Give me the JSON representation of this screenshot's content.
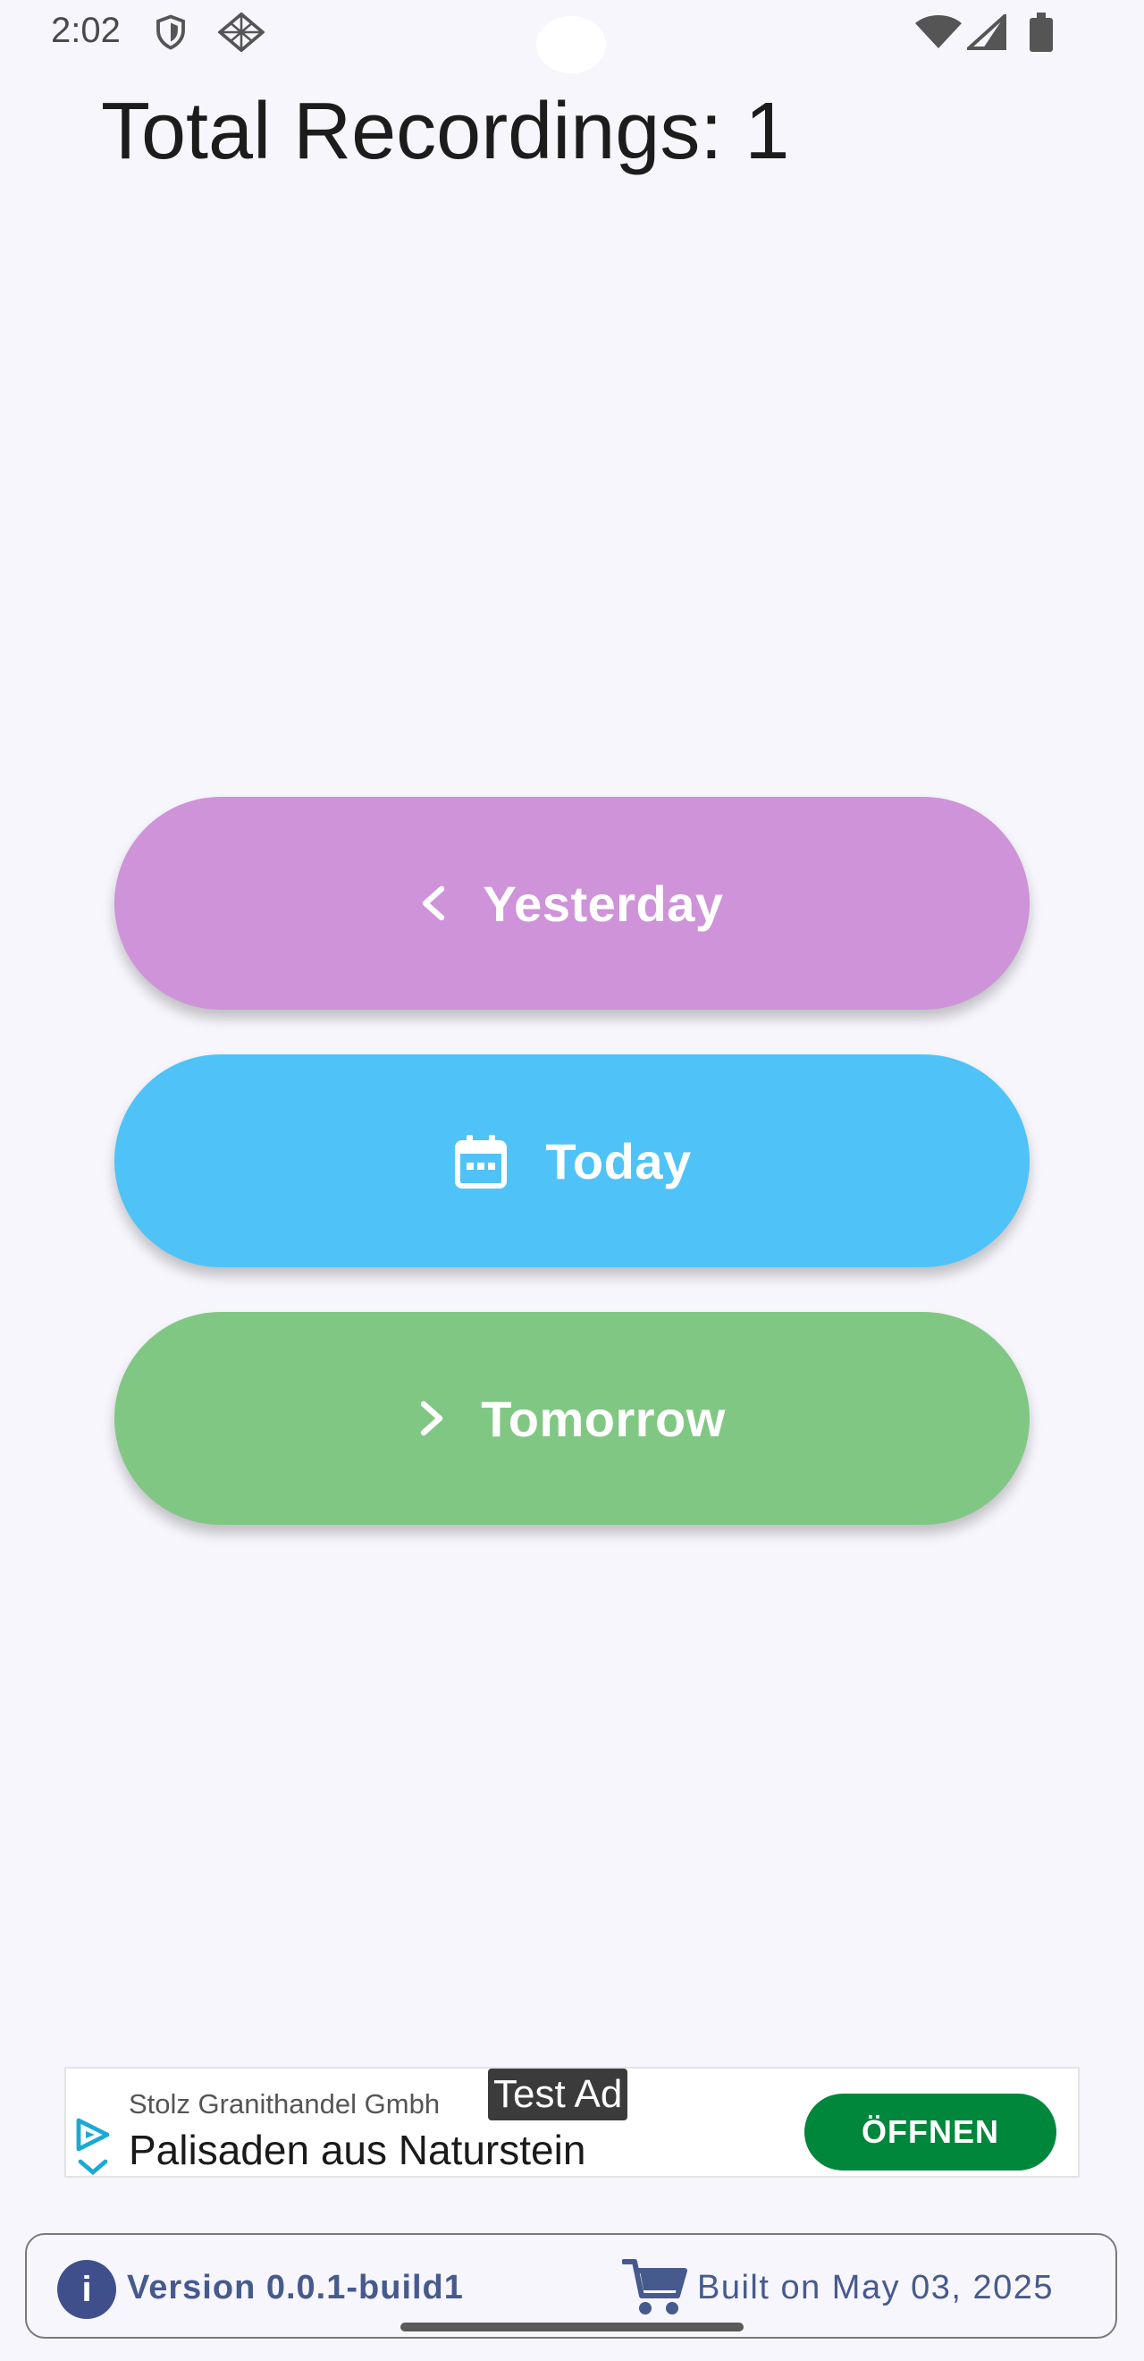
{
  "status_bar": {
    "time": "2:02",
    "left_icons": [
      "shield-icon",
      "diamond-grid-icon"
    ],
    "right_icons": [
      "wifi-icon",
      "signal-icon",
      "battery-icon"
    ]
  },
  "title": "Total Recordings: 1",
  "buttons": [
    {
      "label": "Yesterday",
      "icon": "chevron-left-icon",
      "color": "#ce93d8"
    },
    {
      "label": "Today",
      "icon": "calendar-icon",
      "color": "#4fc3f7"
    },
    {
      "label": "Tomorrow",
      "icon": "chevron-right-icon",
      "color": "#81c784"
    }
  ],
  "ad": {
    "badge": "Test Ad",
    "advertiser": "Stolz Granithandel Gmbh",
    "headline": "Palisaden aus Naturstein",
    "cta": "ÖFFNEN",
    "cta_color": "#00873c"
  },
  "footer": {
    "version": "Version 0.0.1-build1",
    "built": "Built on May 03, 2025",
    "accent_color": "#465a8e"
  }
}
